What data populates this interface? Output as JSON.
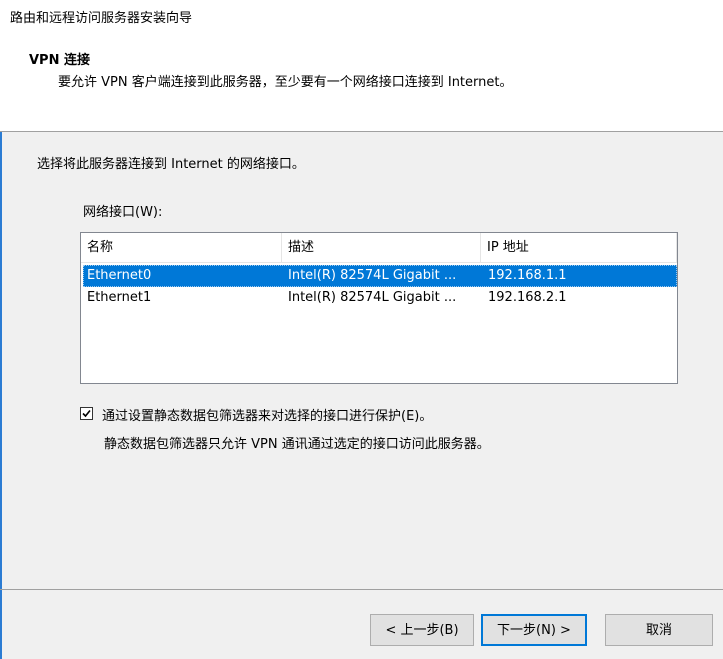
{
  "window": {
    "title": "路由和远程访问服务器安装向导"
  },
  "header": {
    "title": "VPN 连接",
    "subtitle": "要允许 VPN 客户端连接到此服务器，至少要有一个网络接口连接到 Internet。"
  },
  "main": {
    "instruction": "选择将此服务器连接到 Internet 的网络接口。",
    "list_label": "网络接口(W):",
    "columns": {
      "name": "名称",
      "description": "描述",
      "ip": "IP 地址"
    },
    "rows": [
      {
        "name": "Ethernet0",
        "description": "Intel(R) 82574L Gigabit ...",
        "ip": "192.168.1.1",
        "selected": true
      },
      {
        "name": "Ethernet1",
        "description": "Intel(R) 82574L Gigabit ...",
        "ip": "192.168.2.1",
        "selected": false
      }
    ],
    "filter_checkbox": {
      "label": "通过设置静态数据包筛选器来对选择的接口进行保护(E)。",
      "checked": true,
      "description": "静态数据包筛选器只允许 VPN 通讯通过选定的接口访问此服务器。"
    }
  },
  "footer": {
    "back_label": "< 上一步(B)",
    "next_label": "下一步(N) >",
    "cancel_label": "取消"
  },
  "colors": {
    "selection": "#0078d7",
    "background": "#f0f0f0",
    "accent_edge": "#2b7cd3"
  }
}
